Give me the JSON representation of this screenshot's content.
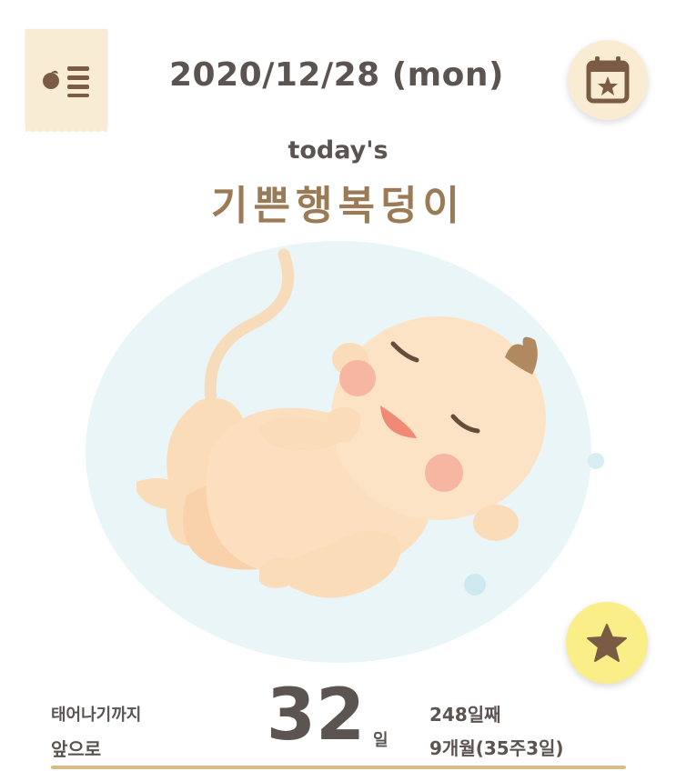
{
  "header": {
    "date": "2020/12/28 (mon)",
    "menu_icon": "menu-list-icon",
    "calendar_icon": "calendar-star-icon"
  },
  "hero": {
    "todays_label": "today's",
    "baby_nickname": "기쁜행복덩이"
  },
  "actions": {
    "favorite_icon": "star-icon"
  },
  "dday": {
    "label_line1": "태어나기까지",
    "label_line2": "앞으로",
    "days_left": "32",
    "days_unit": "일",
    "day_count": "248일째",
    "pregnancy_period": "9개월(35주3일)"
  },
  "colors": {
    "text_dark": "#5b5451",
    "text_brown": "#9b7a56",
    "tag_bg": "#f8ecd4",
    "star_btn_bg": "#f9ee87",
    "underline": "#d9bc8c"
  }
}
